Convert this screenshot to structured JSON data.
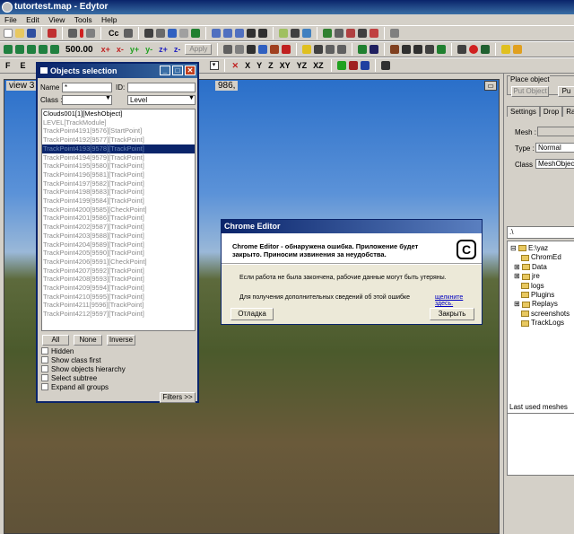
{
  "window": {
    "title": "tutortest.map - Edytor"
  },
  "menu": [
    "File",
    "Edit",
    "View",
    "Tools",
    "Help"
  ],
  "toolbar": {
    "grid_value": "500.00",
    "axis_buttons": [
      "x+",
      "x-",
      "y+",
      "y-",
      "z+",
      "z-"
    ],
    "apply": "Apply",
    "letters": [
      "F",
      "E"
    ],
    "axes": [
      "X",
      "Y",
      "Z",
      "XY",
      "YZ",
      "XZ"
    ]
  },
  "viewport": {
    "label": "view 3",
    "coords": "986,"
  },
  "objects_dialog": {
    "title": "Objects selection",
    "name_label": "Name :",
    "name_value": "*",
    "id_label": "ID:",
    "class_label": "Class :",
    "class_value": "",
    "level_value": "Level",
    "items": [
      "Clouds001[1][MeshObject]",
      "LEVEL[TrackModule]",
      "TrackPoint4191[9576][StartPoint]",
      "TrackPoint4192[9577][TrackPoint]",
      "TrackPoint4193[9578][TrackPoint]",
      "TrackPoint4194[9579][TrackPoint]",
      "TrackPoint4195[9580][TrackPoint]",
      "TrackPoint4196[9581][TrackPoint]",
      "TrackPoint4197[9582][TrackPoint]",
      "TrackPoint4198[9583][TrackPoint]",
      "TrackPoint4199[9584][TrackPoint]",
      "TrackPoint4200[9585][CheckPoint]",
      "TrackPoint4201[9586][TrackPoint]",
      "TrackPoint4202[9587][TrackPoint]",
      "TrackPoint4203[9588][TrackPoint]",
      "TrackPoint4204[9589][TrackPoint]",
      "TrackPoint4205[9590][TrackPoint]",
      "TrackPoint4206[9591][CheckPoint]",
      "TrackPoint4207[9592][TrackPoint]",
      "TrackPoint4208[9593][TrackPoint]",
      "TrackPoint4209[9594][TrackPoint]",
      "TrackPoint4210[9595][TrackPoint]",
      "TrackPoint4211[9596][TrackPoint]",
      "TrackPoint4212[9597][TrackPoint]"
    ],
    "selected_index": 4,
    "buttons": {
      "all": "All",
      "none": "None",
      "inverse": "Inverse",
      "filters": "Filters >>"
    },
    "checks": [
      "Hidden",
      "Show class first",
      "Show objects hierarchy",
      "Select subtree",
      "Expand all groups"
    ]
  },
  "error_dialog": {
    "title": "Chrome Editor",
    "heading": "Chrome Editor - обнаружена ошибка. Приложение будет закрыто. Приносим извинения за неудобства.",
    "line1": "Если работа не была закончена, рабочие данные могут быть утеряны.",
    "line2": "Для получения дополнительных сведений об этой ошибке",
    "link": "щелкните здесь.",
    "debug": "Отладка",
    "close": "Закрыть"
  },
  "right_panel": {
    "place_object": "Place object",
    "put_object": "Put Object",
    "put_short": "Pu",
    "tabs": [
      "Settings",
      "Drop",
      "Rand"
    ],
    "mesh_label": "Mesh :",
    "type_label": "Type :",
    "type_value": "Normal",
    "class_label": "Class :",
    "class_value": "MeshObject",
    "path": ".\\",
    "tree": [
      "E:\\yaz",
      "ChromEd",
      "Data",
      "jre",
      "logs",
      "Plugins",
      "Replays",
      "screenshots",
      "TrackLogs"
    ],
    "last_used": "Last used meshes"
  }
}
